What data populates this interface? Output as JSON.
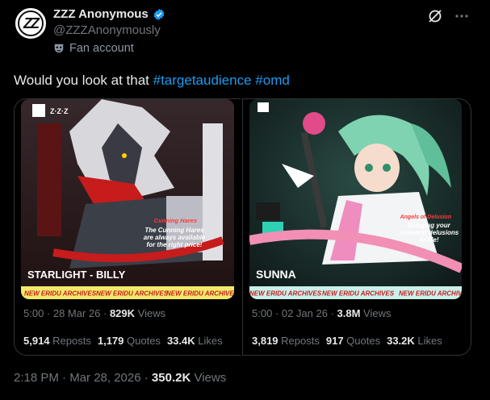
{
  "author": {
    "name": "ZZZ Anonymous",
    "handle": "@ZZZAnonymously",
    "label": "Fan account",
    "avatar_text": "ZZ"
  },
  "tweet": {
    "text": "Would you look at that ",
    "hashtags": [
      "#targetaudience",
      "#omd"
    ]
  },
  "icons": {
    "verified": "verified-badge-icon",
    "mask": "mask-icon",
    "grok": "grok-icon",
    "more": "more-icon"
  },
  "cards": [
    {
      "image_texts": {
        "logo": "Z·Z·Z",
        "tagline_title": "Cunning Hares",
        "tagline": "The Cunning Hares are always available for the right price!",
        "name": "STARLIGHT - BILLY",
        "banner": "NEW ERIDU ARCHIVES"
      },
      "date": "5:00 · 28 Mar 26 · ",
      "views_value": "829K",
      "views_label": " Views",
      "reposts": "5,914",
      "reposts_label": " Reposts",
      "quotes": "1,179",
      "quotes_label": " Quotes",
      "likes": "33.4K",
      "likes_label": " Likes"
    },
    {
      "image_texts": {
        "tagline_title": "Angels of Delusion",
        "tagline": "Bringing your sweetest delusions to life!",
        "name": "SUNNA",
        "banner": "NEW ERIDU ARCHIVES"
      },
      "date": "5:00 · 02 Jan 26 · ",
      "views_value": "3.8M",
      "views_label": " Views",
      "reposts": "3,819",
      "reposts_label": " Reposts",
      "quotes": "917",
      "quotes_label": " Quotes",
      "likes": "33.2K",
      "likes_label": " Likes"
    }
  ],
  "footer": {
    "time": "2:18 PM · Mar 28, 2026 · ",
    "views_value": "350.2K",
    "views_label": " Views"
  },
  "colors": {
    "accent": "#1d9bf0",
    "background": "#000000",
    "text": "#e7e9ea",
    "muted": "#71767b",
    "border": "#2f3336"
  }
}
